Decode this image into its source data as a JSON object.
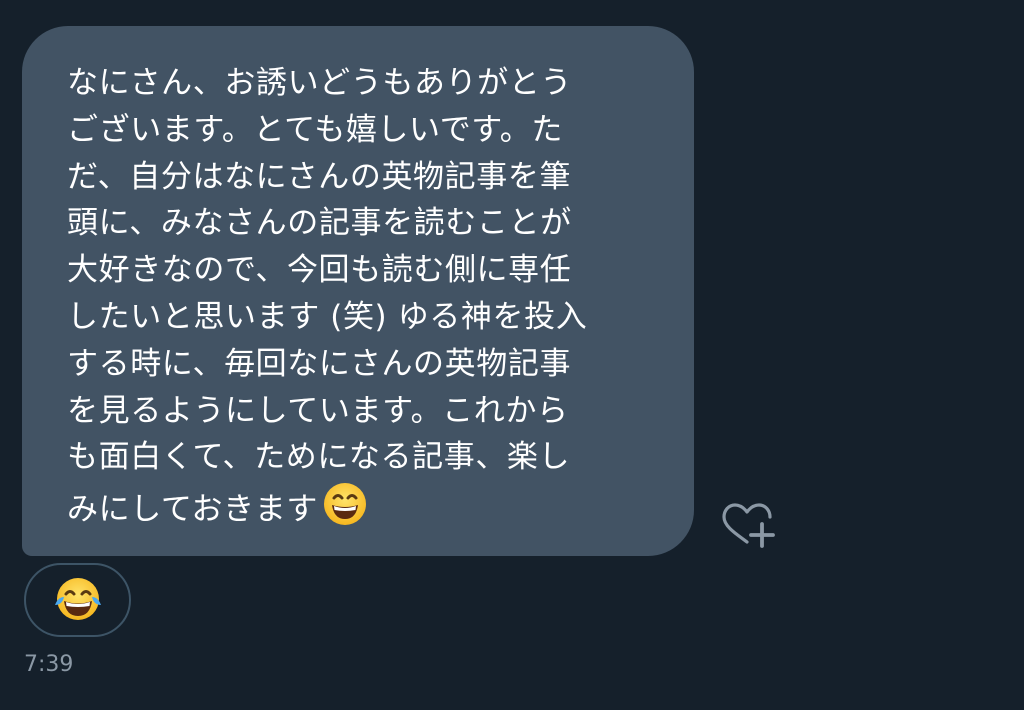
{
  "message": {
    "lines": [
      "なにさん、お誘いどうもありがとう",
      "ございます。とても嬉しいです。た",
      "だ、自分はなにさんの英物記事を筆",
      "頭に、みなさんの記事を読むことが",
      "大好きなので、今回も読む側に専任",
      "したいと思います (笑) ゆる神を投入",
      "する時に、毎回なにさんの英物記事",
      "を見るようにしています。これから",
      "も面白くて、ためになる記事、楽し",
      "みにしておきます"
    ],
    "trailing_emoji": "grinning-face-with-smiling-eyes"
  },
  "reaction": {
    "emoji": "face-with-tears-of-joy"
  },
  "add_reaction_icon": "heart-plus-icon",
  "timestamp": "7:39",
  "colors": {
    "background": "#15202b",
    "bubble": "#425364",
    "text": "#ffffff",
    "muted": "#8b98a5",
    "pill_border": "#3d5466"
  }
}
